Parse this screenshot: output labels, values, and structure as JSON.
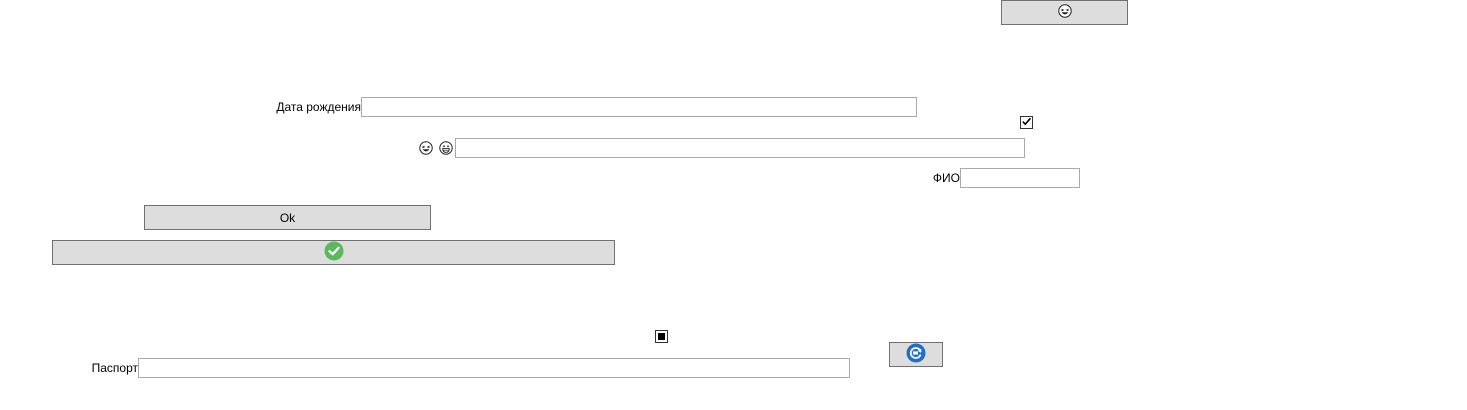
{
  "top_button": {
    "icon": "laughing-emoji-icon"
  },
  "birth_date": {
    "label": "Дата рождения",
    "value": ""
  },
  "checkbox_checked": {
    "checked": true,
    "icon": "checkmark-icon"
  },
  "emoji_field": {
    "icons": [
      "laughing-emoji-icon",
      "grinning-emoji-icon"
    ],
    "value": ""
  },
  "fio": {
    "label": "ФИО",
    "value": ""
  },
  "ok_button": {
    "label": "Ok"
  },
  "confirm_button": {
    "icon": "green-check-circle-icon",
    "color": "#5cb85c"
  },
  "checkbox_indeterminate": {
    "state": "indeterminate"
  },
  "passport": {
    "label": "Паспорт",
    "value": ""
  },
  "refresh_button": {
    "icon": "blue-refresh-circle-icon",
    "color": "#1f6fc9"
  }
}
